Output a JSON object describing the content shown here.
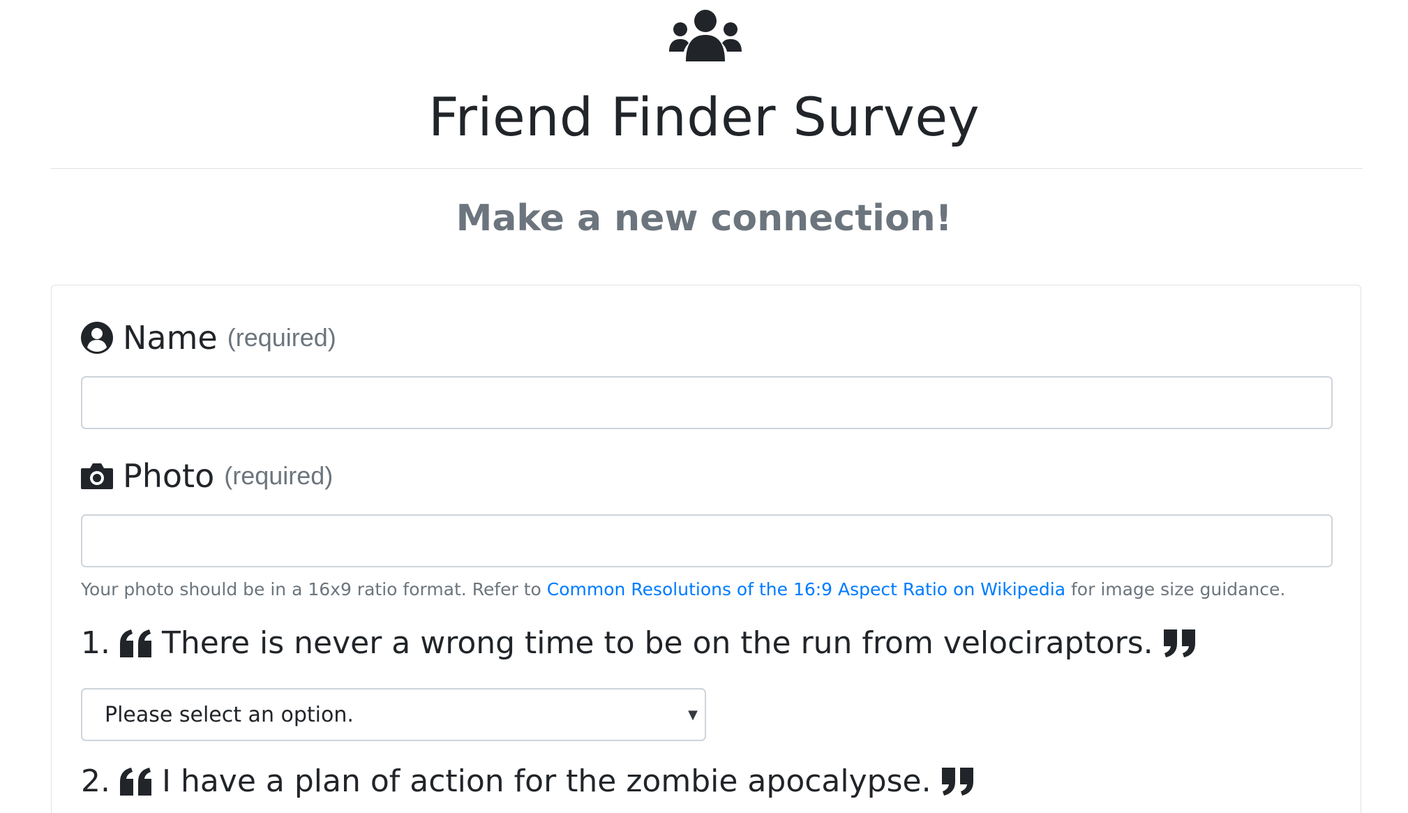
{
  "header": {
    "icon": "users-icon",
    "title": "Friend Finder Survey",
    "subtitle": "Make a new connection!"
  },
  "form": {
    "name_field": {
      "icon": "user-circle-icon",
      "label": "Name",
      "required_note": "(required)",
      "value": ""
    },
    "photo_field": {
      "icon": "camera-icon",
      "label": "Photo",
      "required_note": "(required)",
      "value": "",
      "help_prefix": "Your photo should be in a 16x9 ratio format. Refer to ",
      "help_link": "Common Resolutions of the 16:9 Aspect Ratio on Wikipedia",
      "help_suffix": " for image size guidance."
    },
    "questions": [
      {
        "number": "1.",
        "text": "There is never a wrong time to be on the run from velociraptors.",
        "selected": "Please select an option."
      },
      {
        "number": "2.",
        "text": "I have a plan of action for the zombie apocalypse."
      }
    ]
  },
  "colors": {
    "text": "#212529",
    "muted": "#6c757d",
    "link": "#007bff",
    "border": "#dee2e6",
    "input_border": "#ced4da"
  }
}
